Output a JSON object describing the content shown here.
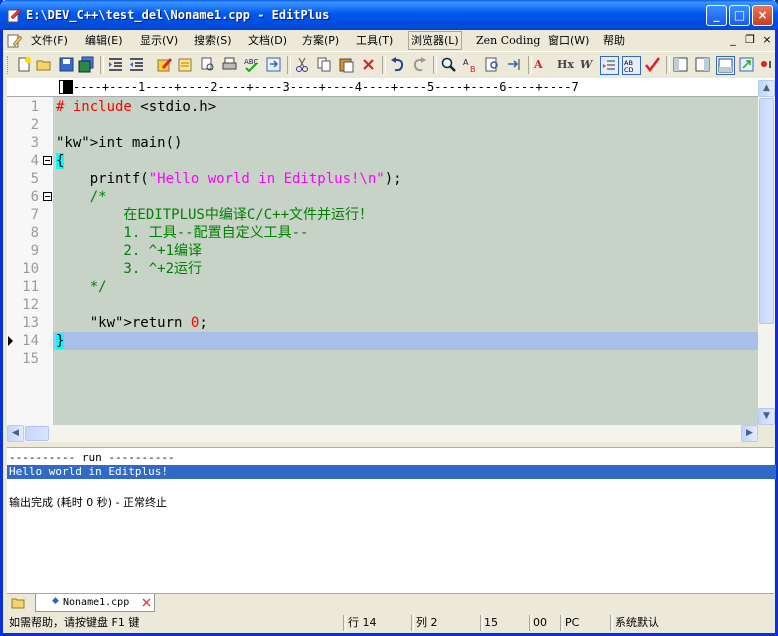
{
  "window": {
    "title": "E:\\DEV_C++\\test_del\\Noname1.cpp - EditPlus"
  },
  "title_buttons": {
    "minimize": "_",
    "maximize": "□",
    "close": "×"
  },
  "menu": [
    "文件(F)",
    "编辑(E)",
    "显示(V)",
    "搜索(S)",
    "文档(D)",
    "方案(P)",
    "工具(T)",
    "浏览器(L)",
    "Zen Coding",
    "窗口(W)",
    "帮助"
  ],
  "mdi_buttons": {
    "minimize": "_",
    "restore": "❐",
    "close": "×"
  },
  "toolbar_text": {
    "hex": "Hx",
    "word_wrap": "W",
    "ab": "A",
    "abcd": "AB"
  },
  "ruler": "----+----1----+----2----+----3----+----4----+----5----+----6----+----7",
  "editor": {
    "lines": [
      {
        "n": "1",
        "t": "# include <stdio.h>"
      },
      {
        "n": "2",
        "t": ""
      },
      {
        "n": "3",
        "t": "int main()"
      },
      {
        "n": "4",
        "t": "{"
      },
      {
        "n": "5",
        "t": "    printf(\"Hello world in Editplus!\\n\");"
      },
      {
        "n": "6",
        "t": "    /*"
      },
      {
        "n": "7",
        "t": "        在EDITPLUS中编译C/C++文件并运行！"
      },
      {
        "n": "8",
        "t": "        1. 工具--配置自定义工具--"
      },
      {
        "n": "9",
        "t": "        2. ^+1编译"
      },
      {
        "n": "10",
        "t": "        3. ^+2运行"
      },
      {
        "n": "11",
        "t": "    */"
      },
      {
        "n": "12",
        "t": ""
      },
      {
        "n": "13",
        "t": "    return 0;"
      },
      {
        "n": "14",
        "t": "}"
      },
      {
        "n": "15",
        "t": ""
      }
    ],
    "current_line": 14
  },
  "output": {
    "lines": [
      "---------- run ----------",
      "Hello world in Editplus!",
      "",
      "输出完成 (耗时 0 秒) - 正常终止"
    ],
    "selected_line": 1
  },
  "tabs": [
    {
      "label": "Noname1.cpp"
    }
  ],
  "status": {
    "help": "如需帮助，请按键盘 F1 键",
    "line": "行 14",
    "col": "列 2",
    "total": "15",
    "code": "00",
    "format": "PC",
    "encoding": "系统默认"
  },
  "colors": {
    "editor_bg": "#c8d3c8",
    "current_line": "#a6c0ea",
    "keyword": "#0000ff",
    "preprocessor": "#ff0000",
    "string": "#ff00ff",
    "comment": "#008000",
    "selection": "#316ac5"
  }
}
